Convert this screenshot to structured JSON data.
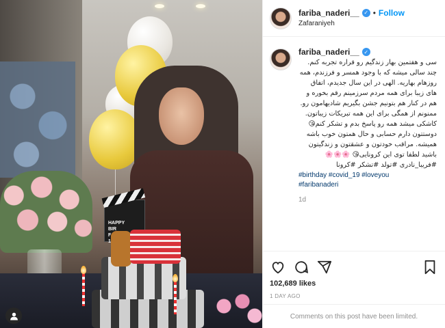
{
  "photo": {
    "clapper_text": "HAPPY\nBIR\nFA\n14",
    "user_tag_icon": "person-icon"
  },
  "header": {
    "username": "fariba_naderi__",
    "separator": "•",
    "follow_label": "Follow",
    "location": "Zafaraniyeh",
    "verified_icon": "verified-badge-icon"
  },
  "caption": {
    "username": "fariba_naderi__",
    "text": "سی و هفتمین بهار زندگیم رو قراره تجربه کنم. چند سالی میشه که با وجود همسر و فرزندم، همه روزهام بهاریه. الهی در این سال جدیدم، اتفاق های زیبا برای همه مردم سرزمینم رقم بخوره و هم در کنار هم بتونیم جشن بگیریم شادیهامون رو. ممنونم از همگی برای این همه تبریکات زیباتون. کاشکی میشد همه رو پاسخ بدم و تشکر کنم😘 دوستتون دارم حسابی و حال همتون خوب باشه همیشه. مراقب خودتون و عشقتون و زندگیتون باشید لطفا توی این کرونایی😘 🌸🌸🌸 #فریبا_نادری #تولد #تشکر #کرونا",
    "hashtags": [
      "#birthday",
      "#covid_19",
      "#loveyou",
      "#faribanaderi"
    ],
    "age": "1d"
  },
  "actions": {
    "like_icon": "heart-icon",
    "comment_icon": "comment-icon",
    "share_icon": "share-icon",
    "save_icon": "bookmark-icon",
    "likes": "102,689 likes",
    "date": "1 DAY AGO"
  },
  "comments_notice": "Comments on this post have been limited."
}
